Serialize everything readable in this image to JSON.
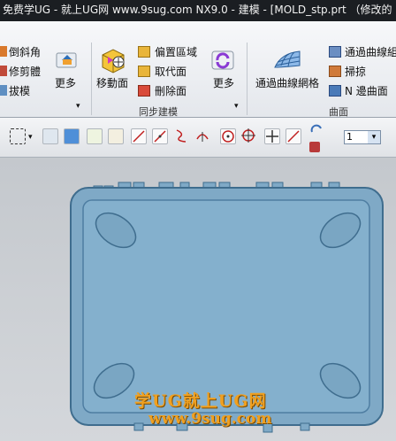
{
  "window": {
    "title": "免费学UG - 就上UG网 www.9sug.com   NX9.0 - 建模 - [MOLD_stp.prt （修改的"
  },
  "ribbon": {
    "left_items": [
      "倒斜角",
      "修剪體",
      "拔模"
    ],
    "more1": "更多",
    "move_face": "移動面",
    "sync_items": [
      "偏置區域",
      "取代面",
      "刪除面"
    ],
    "more2": "更多",
    "sync_group": "同步建模",
    "mesh_button": "通過曲線網格",
    "surface_items": [
      "通過曲線組",
      "掃掠",
      "N 邊曲面"
    ],
    "surface_group": "曲面"
  },
  "toolbar": {
    "layer_value": "1"
  },
  "watermark": {
    "line1": "学UG就上UG网",
    "line2": "www.9sug.com"
  },
  "colors": {
    "part_fill": "#7fa9c6",
    "part_edge": "#3f6d8e",
    "title_bg": "#1b1e22"
  }
}
